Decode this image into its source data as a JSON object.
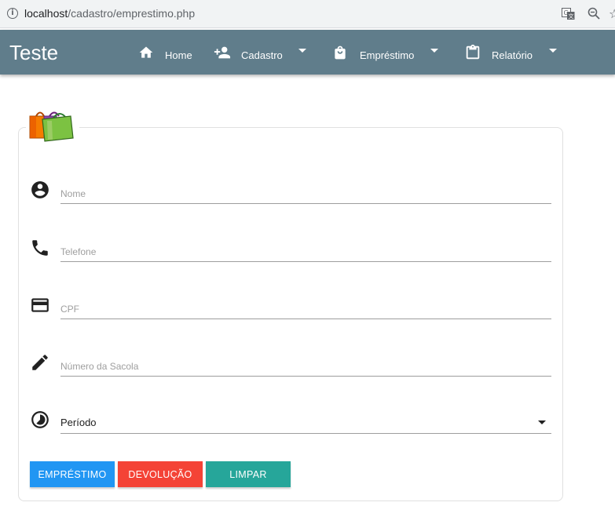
{
  "browser": {
    "url_host": "localhost",
    "url_path": "/cadastro/emprestimo.php"
  },
  "navbar": {
    "brand": "Teste",
    "items": [
      {
        "label": "Home",
        "icon": "home-icon"
      },
      {
        "label": "Cadastro",
        "icon": "person-add-icon"
      },
      {
        "label": "Empréstimo",
        "icon": "shopping-bag-icon"
      },
      {
        "label": "Relatório",
        "icon": "clipboard-icon"
      }
    ]
  },
  "form": {
    "fields": [
      {
        "placeholder": "Nome",
        "icon": "account-circle-icon"
      },
      {
        "placeholder": "Telefone",
        "icon": "phone-icon"
      },
      {
        "placeholder": "CPF",
        "icon": "credit-card-icon"
      },
      {
        "placeholder": "Número da Sacola",
        "icon": "pencil-icon"
      }
    ],
    "period": {
      "value": "Período",
      "icon": "timelapse-icon"
    },
    "buttons": {
      "emprestimo": "EMPRÉSTIMO",
      "devolucao": "DEVOLUÇÃO",
      "limpar": "LIMPAR"
    }
  },
  "colors": {
    "navbar": "#607d8b",
    "btn_emprestimo": "#2196f3",
    "btn_devolucao": "#f44336",
    "btn_limpar": "#26a69a"
  }
}
